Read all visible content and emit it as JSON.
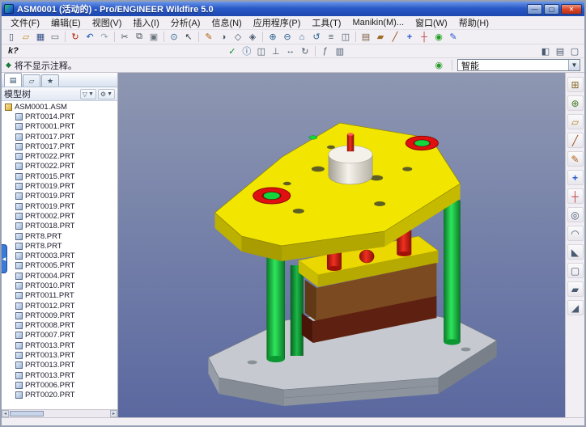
{
  "window": {
    "title": "ASM0001 (活动的) - Pro/ENGINEER Wildfire 5.0",
    "controls": [
      {
        "name": "minimize-button",
        "glyph": "—",
        "css": "winbtn",
        "inter": "true"
      },
      {
        "name": "maximize-button",
        "glyph": "▢",
        "css": "winbtn",
        "inter": "true"
      },
      {
        "name": "close-button",
        "glyph": "✕",
        "css": "winbtn close",
        "inter": "true"
      }
    ]
  },
  "menu": {
    "items": [
      "文件(F)",
      "编辑(E)",
      "视图(V)",
      "插入(I)",
      "分析(A)",
      "信息(N)",
      "应用程序(P)",
      "工具(T)",
      "Manikin(M)...",
      "窗口(W)",
      "帮助(H)"
    ]
  },
  "toolbar_main": {
    "icons": [
      {
        "name": "new-file-icon",
        "glyph": "▯",
        "css": "tbtn",
        "style": "color:#3a4a6a",
        "inter": "true"
      },
      {
        "name": "open-folder-icon",
        "glyph": "▱",
        "css": "tbtn",
        "style": "color:#c08a20",
        "inter": "true"
      },
      {
        "name": "save-icon",
        "glyph": "▦",
        "css": "tbtn",
        "style": "color:#35508a",
        "inter": "true"
      },
      {
        "name": "print-icon",
        "glyph": "▭",
        "css": "tbtn",
        "style": "color:#5a6470",
        "inter": "true"
      },
      {
        "name": "separator",
        "glyph": "",
        "css": "tsep",
        "style": "",
        "inter": "false"
      },
      {
        "name": "regenerate-icon",
        "glyph": "↻",
        "css": "tbtn",
        "style": "color:#b42000",
        "inter": "true"
      },
      {
        "name": "undo-icon",
        "glyph": "↶",
        "css": "tbtn",
        "style": "color:#0a56b4",
        "inter": "true"
      },
      {
        "name": "redo-icon",
        "glyph": "↷",
        "css": "tbtn",
        "style": "color:#93a2b4",
        "inter": "true"
      },
      {
        "name": "separator",
        "glyph": "",
        "css": "tsep",
        "style": "",
        "inter": "false"
      },
      {
        "name": "cut-icon",
        "glyph": "✂",
        "css": "tbtn",
        "style": "color:#45505c",
        "inter": "true"
      },
      {
        "name": "copy-icon",
        "glyph": "⧉",
        "css": "tbtn",
        "style": "color:#45505c",
        "inter": "true"
      },
      {
        "name": "paste-icon",
        "glyph": "▣",
        "css": "tbtn",
        "style": "color:#6a7480",
        "inter": "true"
      },
      {
        "name": "separator",
        "glyph": "",
        "css": "tsep",
        "style": "",
        "inter": "false"
      },
      {
        "name": "search-icon",
        "glyph": "⊙",
        "css": "tbtn",
        "style": "color:#2a6090",
        "inter": "true"
      },
      {
        "name": "select-arrow-icon",
        "glyph": "↖",
        "css": "tbtn",
        "style": "color:#333a44",
        "inter": "true"
      },
      {
        "name": "separator",
        "glyph": "",
        "css": "tsep",
        "style": "",
        "inter": "false"
      },
      {
        "name": "repaint-icon",
        "glyph": "✎",
        "css": "tbtn",
        "style": "color:#b06010",
        "inter": "true"
      },
      {
        "name": "shaded-display-icon",
        "glyph": "◑",
        "css": "tbtn",
        "style": "color:#4a5a70",
        "inter": "true"
      },
      {
        "name": "no-hidden-display-icon",
        "glyph": "◇",
        "css": "tbtn",
        "style": "color:#4a5a70",
        "inter": "true"
      },
      {
        "name": "hidden-line-display-icon",
        "glyph": "◈",
        "css": "tbtn",
        "style": "color:#4a5a70",
        "inter": "true"
      },
      {
        "name": "separator",
        "glyph": "",
        "css": "tsep",
        "style": "",
        "inter": "false"
      },
      {
        "name": "zoom-in-icon",
        "glyph": "⊕",
        "css": "tbtn",
        "style": "color:#2a6090",
        "inter": "true"
      },
      {
        "name": "zoom-out-icon",
        "glyph": "⊖",
        "css": "tbtn",
        "style": "color:#2a6090",
        "inter": "true"
      },
      {
        "name": "refit-icon",
        "glyph": "⌂",
        "css": "tbtn",
        "style": "color:#2a6090",
        "inter": "true"
      },
      {
        "name": "reorient-icon",
        "glyph": "↺",
        "css": "tbtn",
        "style": "color:#2a6090",
        "inter": "true"
      },
      {
        "name": "saved-views-icon",
        "glyph": "≡",
        "css": "tbtn",
        "style": "color:#4a5a70",
        "inter": "true"
      },
      {
        "name": "view-manager-icon",
        "glyph": "◫",
        "css": "tbtn",
        "style": "color:#4a5a70",
        "inter": "true"
      },
      {
        "name": "separator",
        "glyph": "",
        "css": "tsep",
        "style": "",
        "inter": "false"
      },
      {
        "name": "layers-icon",
        "glyph": "▤",
        "css": "tbtn",
        "style": "color:#7a6040",
        "inter": "true"
      },
      {
        "name": "datum-planes-toggle-icon",
        "glyph": "▰",
        "css": "tbtn",
        "style": "color:#a06a28",
        "inter": "true"
      },
      {
        "name": "datum-axes-toggle-icon",
        "glyph": "╱",
        "css": "tbtn",
        "style": "color:#963f10",
        "inter": "true"
      },
      {
        "name": "datum-points-toggle-icon",
        "glyph": "+",
        "css": "tbtn",
        "style": "color:#2255cc;font-weight:bold",
        "inter": "true"
      },
      {
        "name": "csys-toggle-icon",
        "glyph": "┼",
        "css": "tbtn",
        "style": "color:#bb3333",
        "inter": "true"
      },
      {
        "name": "spin-center-toggle-icon",
        "glyph": "◉",
        "css": "tbtn",
        "style": "color:#22a022",
        "inter": "true"
      },
      {
        "name": "annotation-toggle-icon",
        "glyph": "✎",
        "css": "tbtn",
        "style": "color:#2255cc",
        "inter": "true"
      }
    ]
  },
  "toolbar_second": {
    "icons": [
      {
        "name": "context-help-icon",
        "glyph": "k?",
        "css": "tbtn khelp",
        "style": "color:#1a1a1a",
        "inter": "true"
      },
      {
        "name": "spacer",
        "glyph": "",
        "css": "tspace",
        "style": "",
        "inter": "false"
      },
      {
        "name": "verify-icon",
        "glyph": "✓",
        "css": "tbtn",
        "style": "color:#0a8a2a",
        "inter": "true"
      },
      {
        "name": "info-icon",
        "glyph": "ⓘ",
        "css": "tbtn",
        "style": "color:#2a6090",
        "inter": "true"
      },
      {
        "name": "feature-refs-icon",
        "glyph": "◫",
        "css": "tbtn",
        "style": "color:#4a5a70",
        "inter": "true"
      },
      {
        "name": "constraints-icon",
        "glyph": "⊥",
        "css": "tbtn",
        "style": "color:#4a5a70",
        "inter": "true"
      },
      {
        "name": "move-component-icon",
        "glyph": "↔",
        "css": "tbtn",
        "style": "color:#4a5a70",
        "inter": "true"
      },
      {
        "name": "rotate-component-icon",
        "glyph": "↻",
        "css": "tbtn",
        "style": "color:#4a5a70",
        "inter": "true"
      },
      {
        "name": "separator",
        "glyph": "",
        "css": "tsep",
        "style": "",
        "inter": "false"
      },
      {
        "name": "relations-icon",
        "glyph": "ƒ",
        "css": "tbtn",
        "style": "color:#4a5a70",
        "inter": "true"
      },
      {
        "name": "parameters-icon",
        "glyph": "▥",
        "css": "tbtn",
        "style": "color:#4a5a70",
        "inter": "true"
      },
      {
        "name": "flex-spacer",
        "glyph": "",
        "css": "tflex",
        "style": "",
        "inter": "false"
      },
      {
        "name": "display-settings-icon",
        "glyph": "◧",
        "css": "tbtn",
        "style": "color:#4a5a70",
        "inter": "true"
      },
      {
        "name": "model-tree-toggle-icon",
        "glyph": "▤",
        "css": "tbtn",
        "style": "color:#4a5a70",
        "inter": "true"
      },
      {
        "name": "close-pane-icon",
        "glyph": "▢",
        "css": "tbtn",
        "style": "color:#4a5a70",
        "inter": "true"
      }
    ]
  },
  "status": {
    "prompt_glyph": "◆",
    "message": "将不显示注释。",
    "filter_icon_glyph": "◉",
    "filter_label": "智能",
    "combo_arrow_glyph": "▼"
  },
  "navigator": {
    "tabs": [
      {
        "name": "tab-model-tree",
        "glyph": "▤",
        "css": "nav-tab active",
        "inter": "true"
      },
      {
        "name": "tab-folder-browser",
        "glyph": "▱",
        "css": "nav-tab",
        "inter": "true"
      },
      {
        "name": "tab-favorites",
        "glyph": "★",
        "css": "nav-tab",
        "inter": "true"
      }
    ],
    "tree": {
      "title": "模型树",
      "show_glyph": "▽",
      "settings_glyph": "⚙",
      "caret_glyph": "▼",
      "root": "ASM0001.ASM",
      "items": [
        "PRT0014.PRT",
        "PRT0001.PRT",
        "PRT0017.PRT",
        "PRT0017.PRT",
        "PRT0022.PRT",
        "PRT0022.PRT",
        "PRT0015.PRT",
        "PRT0019.PRT",
        "PRT0019.PRT",
        "PRT0019.PRT",
        "PRT0002.PRT",
        "PRT0018.PRT",
        "PRT8.PRT",
        "PRT8.PRT",
        "PRT0003.PRT",
        "PRT0005.PRT",
        "PRT0004.PRT",
        "PRT0010.PRT",
        "PRT0011.PRT",
        "PRT0012.PRT",
        "PRT0009.PRT",
        "PRT0008.PRT",
        "PRT0007.PRT",
        "PRT0013.PRT",
        "PRT0013.PRT",
        "PRT0013.PRT",
        "PRT0013.PRT",
        "PRT0006.PRT",
        "PRT0020.PRT"
      ]
    }
  },
  "right_toolbar": {
    "icons": [
      {
        "name": "assemble-component-icon",
        "glyph": "⊞",
        "css": "rbtn",
        "style": "color:#8a6a2a",
        "inter": "true"
      },
      {
        "name": "create-component-icon",
        "glyph": "⊕",
        "css": "rbtn",
        "style": "color:#4a7a2a",
        "inter": "true"
      },
      {
        "name": "datum-plane-icon",
        "glyph": "▱",
        "css": "rbtn",
        "style": "color:#b8862a",
        "inter": "true"
      },
      {
        "name": "datum-axis-icon",
        "glyph": "╱",
        "css": "rbtn",
        "style": "color:#a04a10",
        "inter": "true"
      },
      {
        "name": "sketch-tool-icon",
        "glyph": "✎",
        "css": "rbtn",
        "style": "color:#b06010",
        "inter": "true"
      },
      {
        "name": "datum-point-icon",
        "glyph": "+",
        "css": "rbtn",
        "style": "color:#2255cc;font-weight:bold",
        "inter": "true"
      },
      {
        "name": "coordinate-system-icon",
        "glyph": "┼",
        "css": "rbtn",
        "style": "color:#bb3333",
        "inter": "true"
      },
      {
        "name": "hole-tool-icon",
        "glyph": "◎",
        "css": "rbtn",
        "style": "color:#4a5a70",
        "inter": "true"
      },
      {
        "name": "round-tool-icon",
        "glyph": "◠",
        "css": "rbtn",
        "style": "color:#4a5a70",
        "inter": "true"
      },
      {
        "name": "chamfer-tool-icon",
        "glyph": "◣",
        "css": "rbtn",
        "style": "color:#4a5a70",
        "inter": "true"
      },
      {
        "name": "shell-tool-icon",
        "glyph": "▢",
        "css": "rbtn",
        "style": "color:#4a5a70",
        "inter": "true"
      },
      {
        "name": "rib-tool-icon",
        "glyph": "▰",
        "css": "rbtn",
        "style": "color:#4a5a70",
        "inter": "true"
      },
      {
        "name": "draft-tool-icon",
        "glyph": "◢",
        "css": "rbtn",
        "style": "color:#4a5a70",
        "inter": "true"
      }
    ]
  },
  "collapse_glyph": "◀",
  "palette": {
    "titlebar_blue": "#2a5ac8",
    "ui_bg": "#f1eff3",
    "viewport_top": "#8e97b1",
    "viewport_bottom": "#5a68a0",
    "plate_yellow": "#f2e600",
    "part_red": "#e01010",
    "part_green": "#12d83c",
    "block_brown": "#7c4a20",
    "block_maroon": "#5e2010",
    "base_gray": "#c6cad0",
    "punch_white": "#f4f1ea"
  }
}
